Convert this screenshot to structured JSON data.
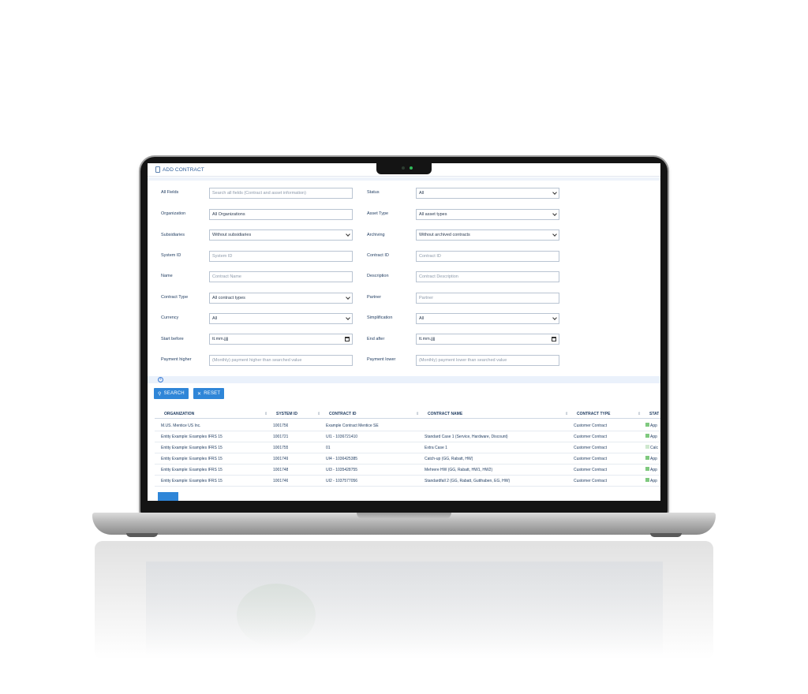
{
  "header": {
    "title": "ADD CONTRACT"
  },
  "filters": {
    "all_fields": {
      "label": "All Fields",
      "placeholder": "Search all fields (Contract and asset information)"
    },
    "status": {
      "label": "Status",
      "value": "All"
    },
    "organization": {
      "label": "Organization",
      "value": "All Organizations"
    },
    "asset_type": {
      "label": "Asset Type",
      "value": "All asset types"
    },
    "subsidiaries": {
      "label": "Subsidiaries",
      "value": "Without subsidiaries"
    },
    "archiving": {
      "label": "Archiving",
      "value": "Without archived contracts"
    },
    "system_id": {
      "label": "System ID",
      "placeholder": "System ID"
    },
    "contract_id": {
      "label": "Contract ID",
      "placeholder": "Contract ID"
    },
    "name": {
      "label": "Name",
      "placeholder": "Contract Name"
    },
    "description": {
      "label": "Description",
      "placeholder": "Contract Description"
    },
    "contract_type": {
      "label": "Contract Type",
      "value": "All contract types"
    },
    "partner": {
      "label": "Partner",
      "placeholder": "Partner"
    },
    "currency": {
      "label": "Currency",
      "value": "All"
    },
    "simplification": {
      "label": "Simplification",
      "value": "All"
    },
    "start_before": {
      "label": "Start before",
      "value": "tt.mm.jjjj"
    },
    "end_after": {
      "label": "End after",
      "value": "tt.mm.jjjj"
    },
    "payment_higher": {
      "label": "Payment higher",
      "placeholder": "(Monthly) payment higher than searched value"
    },
    "payment_lower": {
      "label": "Payment lower",
      "placeholder": "(Monthly) payment lower than searched value"
    }
  },
  "buttons": {
    "search": "SEARCH",
    "reset": "RESET",
    "expand_icon": "+"
  },
  "table": {
    "columns": [
      "ORGANIZATION",
      "SYSTEM ID",
      "CONTRACT ID",
      "CONTRACT NAME",
      "CONTRACT TYPE",
      "STAT"
    ],
    "rows": [
      {
        "organization": "M.US. Mentice US Inc.",
        "system_id": "1001756",
        "contract_id": "Example Contract Mentice SE",
        "contract_name": "",
        "contract_type": "Customer Contract",
        "status": "App"
      },
      {
        "organization": "Entity Example: Examples IFRS 15",
        "system_id": "1001721",
        "contract_id": "UI1 - 1036721410",
        "contract_name": "Standard Case 1 (Service, Hardware, Discount)",
        "contract_type": "Customer Contract",
        "status": "App"
      },
      {
        "organization": "Entity Example: Examples IFRS 15",
        "system_id": "1001755",
        "contract_id": "01",
        "contract_name": "Extra Case 1",
        "contract_type": "Customer Contract",
        "status": "Calc"
      },
      {
        "organization": "Entity Example: Examples IFRS 15",
        "system_id": "1001749",
        "contract_id": "UI4 - 1036425385",
        "contract_name": "Catch-up (GG, Rabatt, HW)",
        "contract_type": "Customer Contract",
        "status": "App"
      },
      {
        "organization": "Entity Example: Examples IFRS 15",
        "system_id": "1001748",
        "contract_id": "UI3 - 1035428755",
        "contract_name": "Mehrere HW (GG, Rabatt, HW1, HW2)",
        "contract_type": "Customer Contract",
        "status": "App"
      },
      {
        "organization": "Entity Example: Examples IFRS 15",
        "system_id": "1001746",
        "contract_id": "UI2 - 1037577056",
        "contract_name": "Standardfall 2 (GG, Rabatt, Gutthaben, EG, HW)",
        "contract_type": "Customer Contract",
        "status": "App"
      }
    ]
  },
  "colors": {
    "accent": "#2f86d8",
    "text": "#1d3a5f",
    "status_green": "#7fc97f"
  }
}
